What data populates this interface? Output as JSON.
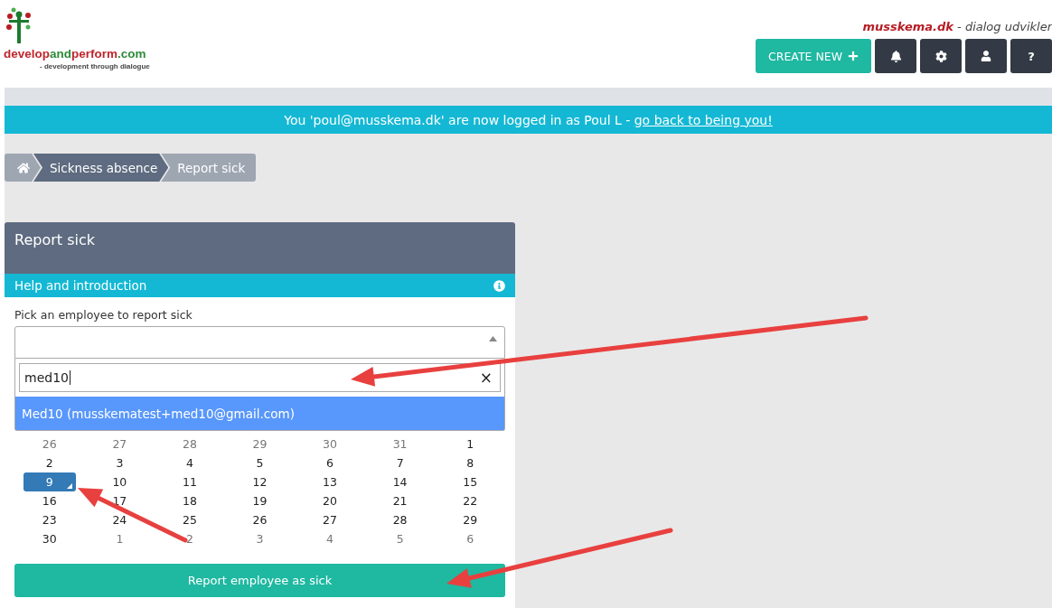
{
  "logo": {
    "parts": [
      {
        "text": "develop",
        "color": "#c0262d"
      },
      {
        "text": "and",
        "color": "#2e8b3a"
      },
      {
        "text": "perform",
        "color": "#c0262d"
      },
      {
        "text": ".com",
        "color": "#2e8b3a"
      }
    ],
    "tagline": "- development through dialogue"
  },
  "brand": {
    "name": "musskema.dk",
    "tagline": "- dialog udvikler"
  },
  "toolbar": {
    "create_label": "CREATE NEW",
    "help_label": "?"
  },
  "banner": {
    "text": "You 'poul@musskema.dk' are now logged in as Poul L - ",
    "link": "go back to being you!"
  },
  "breadcrumb": [
    {
      "kind": "home",
      "selected": false
    },
    {
      "kind": "text",
      "label": "Sickness absence",
      "selected": false
    },
    {
      "kind": "text",
      "label": "Report sick",
      "selected": true
    }
  ],
  "panel": {
    "title": "Report sick",
    "help": "Help and introduction",
    "field_label": "Pick an employee to report sick",
    "search_value": "med10",
    "clear": "×",
    "results": [
      {
        "label": "Med10 (musskematest+med10@gmail.com)",
        "selected": true
      }
    ],
    "weeks": [
      [
        {
          "d": "26",
          "muted": true,
          "selected": false
        },
        {
          "d": "27",
          "muted": true,
          "selected": false
        },
        {
          "d": "28",
          "muted": true,
          "selected": false
        },
        {
          "d": "29",
          "muted": true,
          "selected": false
        },
        {
          "d": "30",
          "muted": true,
          "selected": false
        },
        {
          "d": "31",
          "muted": true,
          "selected": false
        },
        {
          "d": "1",
          "muted": false,
          "selected": false
        }
      ],
      [
        {
          "d": "2",
          "muted": false,
          "selected": false
        },
        {
          "d": "3",
          "muted": false,
          "selected": false
        },
        {
          "d": "4",
          "muted": false,
          "selected": false
        },
        {
          "d": "5",
          "muted": false,
          "selected": false
        },
        {
          "d": "6",
          "muted": false,
          "selected": false
        },
        {
          "d": "7",
          "muted": false,
          "selected": false
        },
        {
          "d": "8",
          "muted": false,
          "selected": false
        }
      ],
      [
        {
          "d": "9",
          "muted": false,
          "selected": true
        },
        {
          "d": "10",
          "muted": false,
          "selected": false
        },
        {
          "d": "11",
          "muted": false,
          "selected": false
        },
        {
          "d": "12",
          "muted": false,
          "selected": false
        },
        {
          "d": "13",
          "muted": false,
          "selected": false
        },
        {
          "d": "14",
          "muted": false,
          "selected": false
        },
        {
          "d": "15",
          "muted": false,
          "selected": false
        }
      ],
      [
        {
          "d": "16",
          "muted": false,
          "selected": false
        },
        {
          "d": "17",
          "muted": false,
          "selected": false
        },
        {
          "d": "18",
          "muted": false,
          "selected": false
        },
        {
          "d": "19",
          "muted": false,
          "selected": false
        },
        {
          "d": "20",
          "muted": false,
          "selected": false
        },
        {
          "d": "21",
          "muted": false,
          "selected": false
        },
        {
          "d": "22",
          "muted": false,
          "selected": false
        }
      ],
      [
        {
          "d": "23",
          "muted": false,
          "selected": false
        },
        {
          "d": "24",
          "muted": false,
          "selected": false
        },
        {
          "d": "25",
          "muted": false,
          "selected": false
        },
        {
          "d": "26",
          "muted": false,
          "selected": false
        },
        {
          "d": "27",
          "muted": false,
          "selected": false
        },
        {
          "d": "28",
          "muted": false,
          "selected": false
        },
        {
          "d": "29",
          "muted": false,
          "selected": false
        }
      ],
      [
        {
          "d": "30",
          "muted": false,
          "selected": false
        },
        {
          "d": "1",
          "muted": true,
          "selected": false
        },
        {
          "d": "2",
          "muted": true,
          "selected": false
        },
        {
          "d": "3",
          "muted": true,
          "selected": false
        },
        {
          "d": "4",
          "muted": true,
          "selected": false
        },
        {
          "d": "5",
          "muted": true,
          "selected": false
        },
        {
          "d": "6",
          "muted": true,
          "selected": false
        }
      ]
    ],
    "submit": "Report employee as sick"
  }
}
